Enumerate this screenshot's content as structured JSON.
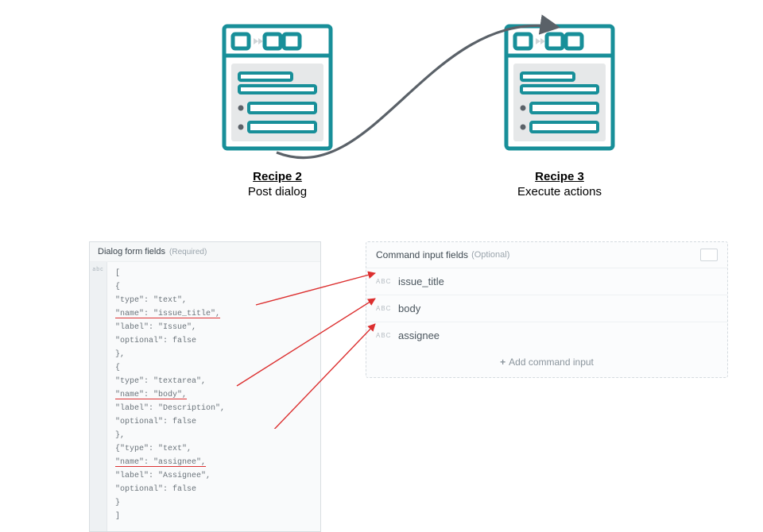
{
  "colors": {
    "teal": "#188f99",
    "grey": "#5a6168",
    "red": "#dc2f2f"
  },
  "recipe_left": {
    "title": "Recipe 2",
    "subtitle": "Post dialog"
  },
  "recipe_right": {
    "title": "Recipe 3",
    "subtitle": "Execute actions"
  },
  "dialog_panel": {
    "header_label": "Dialog form fields",
    "header_hint": "(Required)",
    "gutter_label": "abc",
    "fields": [
      {
        "type": "text",
        "name": "issue_title",
        "label": "Issue",
        "optional": false
      },
      {
        "type": "textarea",
        "name": "body",
        "label": "Description",
        "optional": false
      },
      {
        "type": "text",
        "name": "assignee",
        "label": "Assignee",
        "optional": false
      }
    ],
    "lines": [
      {
        "text": "["
      },
      {
        "text": "{"
      },
      {
        "text": "\"type\": \"text\","
      },
      {
        "text": "\"name\": \"issue_title\",",
        "ul": true
      },
      {
        "text": "\"label\": \"Issue\","
      },
      {
        "text": "\"optional\": false"
      },
      {
        "text": "},"
      },
      {
        "text": "{"
      },
      {
        "text": "\"type\": \"textarea\","
      },
      {
        "text": "\"name\": \"body\",",
        "ul": true
      },
      {
        "text": "\"label\": \"Description\","
      },
      {
        "text": "\"optional\": false"
      },
      {
        "text": "},"
      },
      {
        "text": "{\"type\": \"text\","
      },
      {
        "text": "\"name\": \"assignee\",",
        "ul": true
      },
      {
        "text": "\"label\": \"Assignee\","
      },
      {
        "text": "\"optional\": false"
      },
      {
        "text": "}"
      },
      {
        "text": "]"
      }
    ]
  },
  "command_panel": {
    "header_label": "Command input fields",
    "header_hint": "(Optional)",
    "abc_label": "ABC",
    "rows": [
      {
        "label": "issue_title"
      },
      {
        "label": "body"
      },
      {
        "label": "assignee"
      }
    ],
    "add_label": "Add command input",
    "add_plus": "+"
  }
}
